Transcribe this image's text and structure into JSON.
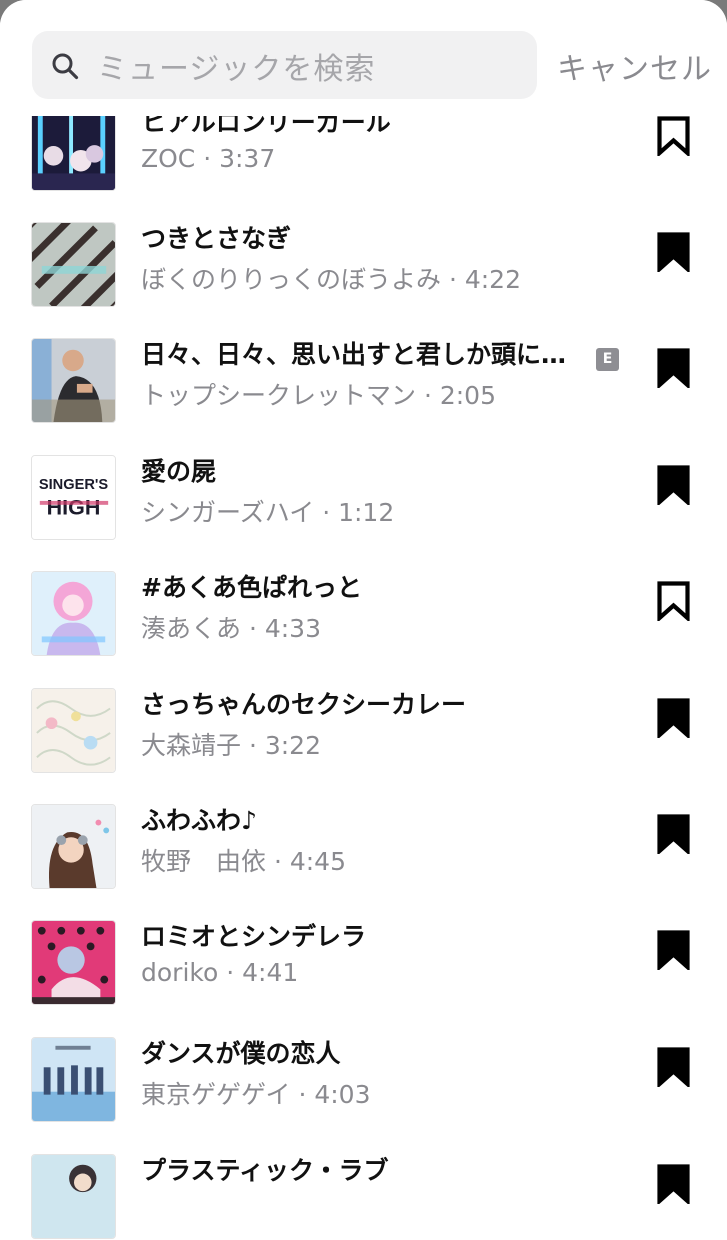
{
  "search": {
    "placeholder": "ミュージックを検索",
    "cancel_label": "キャンセル"
  },
  "tracks": [
    {
      "title": "ヒアルロンリーガール",
      "subtitle": "ZOC · 3:37",
      "saved": false,
      "explicit": false
    },
    {
      "title": "つきとさなぎ",
      "subtitle": "ぼくのりりっくのぼうよみ · 4:22",
      "saved": true,
      "explicit": false
    },
    {
      "title": "日々、日々、思い出すと君しか頭に…",
      "subtitle": "トップシークレットマン · 2:05",
      "saved": true,
      "explicit": true,
      "explicit_label": "E"
    },
    {
      "title": "愛の屍",
      "subtitle": "シンガーズハイ · 1:12",
      "saved": true,
      "explicit": false,
      "cover_text_1": "SINGER'S",
      "cover_text_2": "HIGH"
    },
    {
      "title": "#あくあ色ぱれっと",
      "subtitle": "湊あくあ · 4:33",
      "saved": false,
      "explicit": false
    },
    {
      "title": "さっちゃんのセクシーカレー",
      "subtitle": "大森靖子 · 3:22",
      "saved": true,
      "explicit": false
    },
    {
      "title": "ふわふわ♪",
      "subtitle": "牧野　由依 · 4:45",
      "saved": true,
      "explicit": false
    },
    {
      "title": "ロミオとシンデレラ",
      "subtitle": "doriko · 4:41",
      "saved": true,
      "explicit": false
    },
    {
      "title": "ダンスが僕の恋人",
      "subtitle": "東京ゲゲゲイ · 4:03",
      "saved": true,
      "explicit": false
    },
    {
      "title": "プラスティック・ラブ",
      "subtitle": "",
      "saved": true,
      "explicit": false
    }
  ],
  "colors": {
    "accent": "#000000",
    "secondary_text": "#8a8a8f",
    "search_bg": "#f1f1f2"
  }
}
